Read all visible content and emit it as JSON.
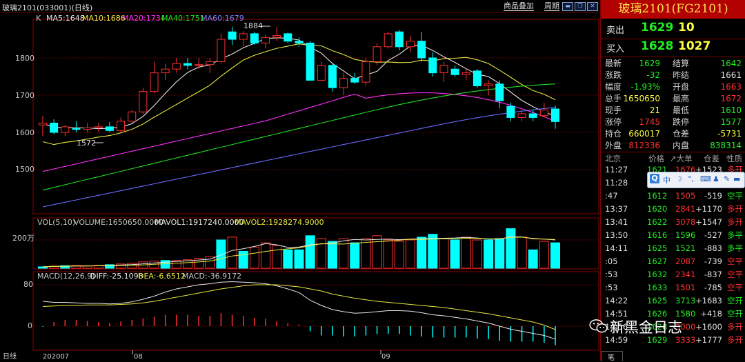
{
  "titlebar": {
    "title": "玻璃2101(033001)(日线)",
    "overlay_label": "商品叠加",
    "period_label": "周期"
  },
  "indicators": {
    "ma_header": {
      "k": "K",
      "ma5": "MA5:1648",
      "ma10": "MA10:1686",
      "ma20": "MA20:1734",
      "ma40": "MA40:1751",
      "ma60": "MA60:1679"
    },
    "vol_header": {
      "vol": "VOL(5,10)",
      "volume": "VOLUME:1650650.0000",
      "mavol1": "MAVOL1:1917240.0000",
      "mavol2": "MAVOL2:1928274.9000"
    },
    "macd_header": {
      "macd": "MACD(12,26,9)",
      "diff": "DIFF:-25.1098",
      "dea": "DEA:-6.6512",
      "macdv": "MACD:-36.9172"
    },
    "high_marker": "1884",
    "low_marker": "1572"
  },
  "axes": {
    "price_ticks": [
      "1800",
      "1700",
      "1600",
      "1500"
    ],
    "vol_tick": "200万",
    "macd_ticks": [
      "80",
      "0"
    ],
    "date_ticks": [
      "202007",
      "08",
      "09"
    ],
    "period_tab": "日线"
  },
  "colors": {
    "up": "#ff3030",
    "down": "#00ffff",
    "ma5": "#e8e8e8",
    "ma10": "#e8e840",
    "ma20": "#ff30ff",
    "ma40": "#20e020",
    "ma60": "#6a6aff",
    "grid": "#8b0000"
  },
  "chart_data": {
    "type": "candlestick",
    "ylim": [
      1420,
      1900
    ],
    "candles": [
      {
        "o": 1620,
        "h": 1645,
        "l": 1590,
        "c": 1625
      },
      {
        "o": 1625,
        "h": 1635,
        "l": 1595,
        "c": 1600
      },
      {
        "o": 1600,
        "h": 1620,
        "l": 1590,
        "c": 1615
      },
      {
        "o": 1610,
        "h": 1630,
        "l": 1600,
        "c": 1608
      },
      {
        "o": 1608,
        "h": 1625,
        "l": 1600,
        "c": 1612
      },
      {
        "o": 1612,
        "h": 1625,
        "l": 1602,
        "c": 1615
      },
      {
        "o": 1615,
        "h": 1628,
        "l": 1600,
        "c": 1605
      },
      {
        "o": 1605,
        "h": 1640,
        "l": 1600,
        "c": 1630
      },
      {
        "o": 1630,
        "h": 1660,
        "l": 1625,
        "c": 1655
      },
      {
        "o": 1655,
        "h": 1720,
        "l": 1650,
        "c": 1710
      },
      {
        "o": 1710,
        "h": 1790,
        "l": 1705,
        "c": 1760
      },
      {
        "o": 1760,
        "h": 1785,
        "l": 1740,
        "c": 1770
      },
      {
        "o": 1770,
        "h": 1800,
        "l": 1760,
        "c": 1785
      },
      {
        "o": 1785,
        "h": 1800,
        "l": 1770,
        "c": 1780
      },
      {
        "o": 1780,
        "h": 1800,
        "l": 1770,
        "c": 1782
      },
      {
        "o": 1782,
        "h": 1800,
        "l": 1760,
        "c": 1790
      },
      {
        "o": 1790,
        "h": 1865,
        "l": 1785,
        "c": 1850
      },
      {
        "o": 1870,
        "h": 1884,
        "l": 1835,
        "c": 1850
      },
      {
        "o": 1850,
        "h": 1872,
        "l": 1830,
        "c": 1865
      },
      {
        "o": 1865,
        "h": 1870,
        "l": 1835,
        "c": 1840
      },
      {
        "o": 1840,
        "h": 1862,
        "l": 1825,
        "c": 1855
      },
      {
        "o": 1855,
        "h": 1884,
        "l": 1845,
        "c": 1860
      },
      {
        "o": 1865,
        "h": 1868,
        "l": 1840,
        "c": 1845
      },
      {
        "o": 1845,
        "h": 1855,
        "l": 1830,
        "c": 1840
      },
      {
        "o": 1840,
        "h": 1845,
        "l": 1760,
        "c": 1740
      },
      {
        "o": 1740,
        "h": 1790,
        "l": 1740,
        "c": 1780
      },
      {
        "o": 1780,
        "h": 1785,
        "l": 1710,
        "c": 1720
      },
      {
        "o": 1720,
        "h": 1760,
        "l": 1700,
        "c": 1745
      },
      {
        "o": 1745,
        "h": 1760,
        "l": 1730,
        "c": 1735
      },
      {
        "o": 1735,
        "h": 1800,
        "l": 1725,
        "c": 1790
      },
      {
        "o": 1790,
        "h": 1840,
        "l": 1780,
        "c": 1830
      },
      {
        "o": 1830,
        "h": 1870,
        "l": 1825,
        "c": 1865
      },
      {
        "o": 1870,
        "h": 1875,
        "l": 1820,
        "c": 1830
      },
      {
        "o": 1830,
        "h": 1860,
        "l": 1815,
        "c": 1845
      },
      {
        "o": 1845,
        "h": 1870,
        "l": 1790,
        "c": 1800
      },
      {
        "o": 1800,
        "h": 1815,
        "l": 1750,
        "c": 1760
      },
      {
        "o": 1760,
        "h": 1790,
        "l": 1735,
        "c": 1780
      },
      {
        "o": 1770,
        "h": 1780,
        "l": 1750,
        "c": 1755
      },
      {
        "o": 1755,
        "h": 1770,
        "l": 1740,
        "c": 1760
      },
      {
        "o": 1765,
        "h": 1770,
        "l": 1720,
        "c": 1725
      },
      {
        "o": 1725,
        "h": 1740,
        "l": 1700,
        "c": 1730
      },
      {
        "o": 1730,
        "h": 1740,
        "l": 1665,
        "c": 1685
      },
      {
        "o": 1670,
        "h": 1680,
        "l": 1630,
        "c": 1640
      },
      {
        "o": 1640,
        "h": 1660,
        "l": 1630,
        "c": 1650
      },
      {
        "o": 1650,
        "h": 1660,
        "l": 1630,
        "c": 1640
      },
      {
        "o": 1645,
        "h": 1680,
        "l": 1640,
        "c": 1660
      },
      {
        "o": 1663,
        "h": 1672,
        "l": 1610,
        "c": 1629
      }
    ],
    "volume": [
      {
        "v": 0.1,
        "up": false
      },
      {
        "v": 0.15,
        "up": true
      },
      {
        "v": 0.18,
        "up": false
      },
      {
        "v": 0.2,
        "up": true
      },
      {
        "v": 0.18,
        "up": true
      },
      {
        "v": 0.2,
        "up": true
      },
      {
        "v": 0.25,
        "up": false
      },
      {
        "v": 0.3,
        "up": true
      },
      {
        "v": 0.35,
        "up": true
      },
      {
        "v": 0.45,
        "up": true
      },
      {
        "v": 0.5,
        "up": true
      },
      {
        "v": 0.55,
        "up": false
      },
      {
        "v": 0.55,
        "up": true
      },
      {
        "v": 0.6,
        "up": true
      },
      {
        "v": 0.7,
        "up": true
      },
      {
        "v": 0.8,
        "up": true
      },
      {
        "v": 2.0,
        "up": false
      },
      {
        "v": 2.2,
        "up": true
      },
      {
        "v": 1.2,
        "up": false
      },
      {
        "v": 1.5,
        "up": true
      },
      {
        "v": 1.8,
        "up": true
      },
      {
        "v": 1.6,
        "up": true
      },
      {
        "v": 1.3,
        "up": false
      },
      {
        "v": 1.3,
        "up": false
      },
      {
        "v": 2.3,
        "up": false
      },
      {
        "v": 2.1,
        "up": true
      },
      {
        "v": 1.9,
        "up": false
      },
      {
        "v": 2.1,
        "up": true
      },
      {
        "v": 1.8,
        "up": false
      },
      {
        "v": 2.1,
        "up": true
      },
      {
        "v": 2.3,
        "up": true
      },
      {
        "v": 2.0,
        "up": true
      },
      {
        "v": 1.9,
        "up": true
      },
      {
        "v": 2.0,
        "up": true
      },
      {
        "v": 2.2,
        "up": false
      },
      {
        "v": 2.4,
        "up": false
      },
      {
        "v": 2.1,
        "up": true
      },
      {
        "v": 2.0,
        "up": false
      },
      {
        "v": 2.2,
        "up": true
      },
      {
        "v": 2.0,
        "up": true
      },
      {
        "v": 2.0,
        "up": false
      },
      {
        "v": 2.1,
        "up": false
      },
      {
        "v": 2.8,
        "up": false
      },
      {
        "v": 2.2,
        "up": true
      },
      {
        "v": 1.3,
        "up": false
      },
      {
        "v": 1.9,
        "up": true
      },
      {
        "v": 1.8,
        "up": false
      }
    ],
    "macd_hist": [
      -1,
      8,
      12,
      12,
      10,
      8,
      6,
      9,
      12,
      15,
      18,
      22,
      22,
      22,
      20,
      20,
      25,
      22,
      20,
      16,
      14,
      10,
      6,
      3,
      -10,
      -18,
      -18,
      -20,
      -20,
      -18,
      -15,
      -15,
      -15,
      -18,
      -20,
      -22,
      -22,
      -22,
      -22,
      -24,
      -25,
      -28,
      -30,
      -30,
      -30,
      -32,
      -36.9
    ],
    "macd_diff": [
      48,
      46,
      46,
      45,
      44,
      44,
      43,
      44,
      47,
      52,
      58,
      66,
      72,
      76,
      80,
      82,
      85,
      86,
      85,
      84,
      82,
      78,
      72,
      65,
      50,
      40,
      32,
      28,
      25,
      26,
      28,
      30,
      30,
      29,
      26,
      22,
      20,
      17,
      14,
      10,
      6,
      0,
      -6,
      -10,
      -14,
      -18,
      -25.1
    ],
    "macd_dea": [
      38,
      39,
      40,
      40,
      41,
      41,
      41,
      42,
      43,
      45,
      48,
      52,
      56,
      60,
      64,
      68,
      72,
      75,
      78,
      80,
      80,
      80,
      78,
      76,
      72,
      68,
      62,
      58,
      54,
      51,
      48,
      46,
      44,
      42,
      40,
      38,
      36,
      33,
      30,
      27,
      24,
      20,
      16,
      12,
      8,
      2,
      -6.65
    ]
  },
  "right_panel": {
    "title": "玻璃2101(FG2101)",
    "sell": {
      "label": "卖出",
      "price": "1629",
      "vol": "10"
    },
    "buy": {
      "label": "买入",
      "price": "1628",
      "vol": "1027"
    },
    "stats": [
      {
        "k1": "最新",
        "v1": "1629",
        "c1": "g",
        "k2": "结算",
        "v2": "1642",
        "c2": "g"
      },
      {
        "k1": "涨跌",
        "v1": "-32",
        "c1": "g",
        "k2": "昨结",
        "v2": "1661",
        "c2": "w"
      },
      {
        "k1": "幅度",
        "v1": "-1.93%",
        "c1": "g",
        "k2": "开盘",
        "v2": "1663",
        "c2": "r"
      },
      {
        "k1": "总手",
        "v1": "1650650",
        "c1": "y",
        "k2": "最高",
        "v2": "1672",
        "c2": "r"
      },
      {
        "k1": "现手",
        "v1": "21",
        "c1": "y",
        "k2": "最低",
        "v2": "1610",
        "c2": "g"
      },
      {
        "k1": "涨停",
        "v1": "1745",
        "c1": "r",
        "k2": "跌停",
        "v2": "1577",
        "c2": "g"
      },
      {
        "k1": "持仓",
        "v1": "660017",
        "c1": "y",
        "k2": "仓差",
        "v2": "-5731",
        "c2": "y"
      },
      {
        "k1": "外盘",
        "v1": "812336",
        "c1": "r",
        "k2": "内盘",
        "v2": "838314",
        "c2": "g"
      }
    ],
    "tick_header": {
      "loc": "北京",
      "price": "价格",
      "big": "↗大单",
      "pos": "仓差",
      "nature": "性质"
    },
    "ticks": [
      {
        "time": "11:27",
        "price": "1621",
        "vol": "1676",
        "pos": "+1523",
        "type": "多开",
        "pc": "g",
        "vc": "r",
        "tc": "r"
      },
      {
        "time": "11:28",
        "price": "",
        "vol": "",
        "pos": "",
        "type": "",
        "pc": "g",
        "vc": "r",
        "tc": "r"
      },
      {
        "time": ":47",
        "price": "1612",
        "vol": "1505",
        "pos": "-519",
        "type": "空平",
        "pc": "g",
        "vc": "r",
        "tc": "g"
      },
      {
        "time": "13:37",
        "price": "1620",
        "vol": "2841",
        "pos": "+1170",
        "type": "多开",
        "pc": "g",
        "vc": "r",
        "tc": "r"
      },
      {
        "time": "13:41",
        "price": "1622",
        "vol": "3078",
        "pos": "+1547",
        "type": "多开",
        "pc": "g",
        "vc": "r",
        "tc": "r"
      },
      {
        "time": "13:50",
        "price": "1616",
        "vol": "1596",
        "pos": "-527",
        "type": "多平",
        "pc": "g",
        "vc": "g",
        "tc": "g"
      },
      {
        "time": "14:11",
        "price": "1625",
        "vol": "1521",
        "pos": "-883",
        "type": "多平",
        "pc": "g",
        "vc": "g",
        "tc": "g"
      },
      {
        "time": ":05",
        "price": "1627",
        "vol": "2087",
        "pos": "-739",
        "type": "空平",
        "pc": "g",
        "vc": "r",
        "tc": "r"
      },
      {
        "time": ":53",
        "price": "1632",
        "vol": "2341",
        "pos": "-837",
        "type": "空平",
        "pc": "g",
        "vc": "r",
        "tc": "r"
      },
      {
        "time": ":53",
        "price": "1633",
        "vol": "1501",
        "pos": "-785",
        "type": "空平",
        "pc": "g",
        "vc": "r",
        "tc": "r"
      },
      {
        "time": "14:22",
        "price": "1625",
        "vol": "3713",
        "pos": "+1683",
        "type": "空开",
        "pc": "g",
        "vc": "g",
        "tc": "g"
      },
      {
        "time": "14:51",
        "price": "1626",
        "vol": "1580",
        "pos": "+418",
        "type": "空开",
        "pc": "g",
        "vc": "g",
        "tc": "g"
      },
      {
        "time": "14:56",
        "price": "1628",
        "vol": "3000",
        "pos": "+1600",
        "type": "多开",
        "pc": "g",
        "vc": "r",
        "tc": "r"
      },
      {
        "time": "14:59",
        "price": "1629",
        "vol": "3333",
        "pos": "+1777",
        "type": "多开",
        "pc": "g",
        "vc": "r",
        "tc": "r"
      }
    ],
    "bottom_tab": "笔"
  },
  "popup": {
    "items": [
      "中",
      "☽",
      "°,",
      "⌨",
      "♟",
      "✎",
      "▬"
    ]
  },
  "watermark": "新黑金日志"
}
